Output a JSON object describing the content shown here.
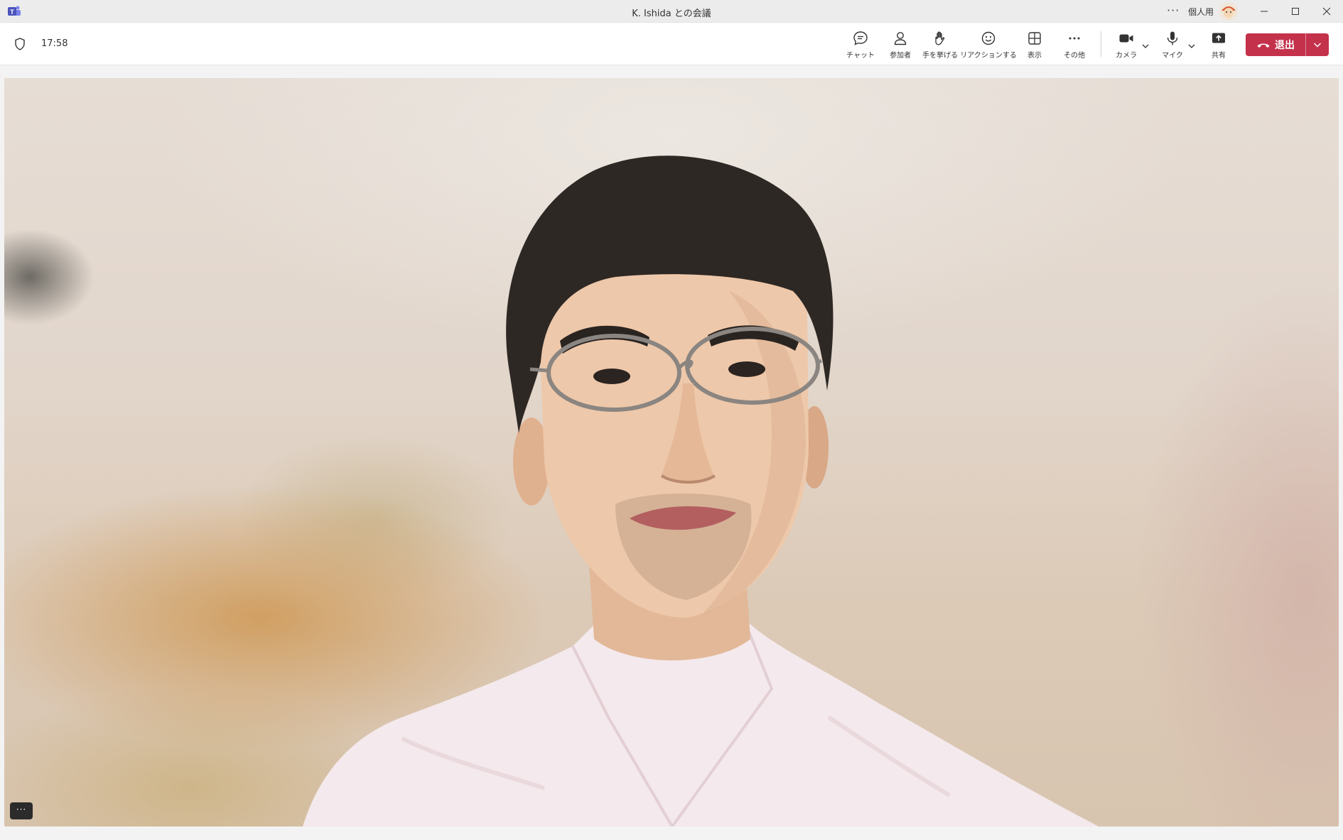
{
  "window": {
    "title": "K. Ishida との会議",
    "more_label": "···",
    "profile_label": "個人用"
  },
  "meeting": {
    "elapsed_time": "17:58"
  },
  "toolbar": {
    "chat_label": "チャット",
    "participants_label": "参加者",
    "raise_hand_label": "手を挙げる",
    "react_label": "リアクションする",
    "view_label": "表示",
    "more_label": "その他",
    "camera_label": "カメラ",
    "mic_label": "マイク",
    "share_label": "共有",
    "leave_label": "退出"
  },
  "video": {
    "overflow_label": "···"
  },
  "colors": {
    "leave_button": "#c4314b",
    "toolbar_bg": "#ffffff",
    "titlebar_bg": "#ececec",
    "app_icon": "#5b5fc7"
  },
  "icons": {
    "app": "teams-icon",
    "security": "shield-icon",
    "chat": "chat-bubble-icon",
    "participants": "person-icon",
    "raise_hand": "hand-icon",
    "react": "smiley-icon",
    "view": "grid-icon",
    "more": "ellipsis-icon",
    "camera": "video-camera-icon",
    "mic": "microphone-icon",
    "share": "share-upload-icon",
    "leave": "phone-hangup-icon"
  }
}
